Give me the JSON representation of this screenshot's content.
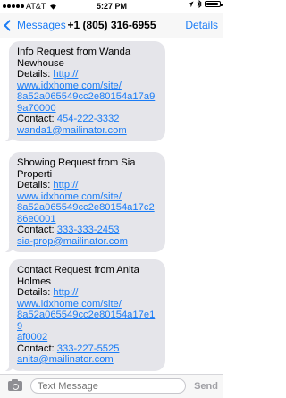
{
  "status_bar": {
    "carrier": "AT&T",
    "time": "5:27 PM",
    "battery_level": 0.95
  },
  "nav": {
    "back_label": "Messages",
    "title": "+1 (805) 316-6955",
    "details_label": "Details"
  },
  "messages": [
    {
      "title_lines": [
        "Info Request from Wanda",
        "Newhouse"
      ],
      "details_label": "Details: ",
      "url_lines": [
        "http://",
        "www.idxhome.com/site/",
        "8a52a065549cc2e80154a17a9",
        "9a70000"
      ],
      "contact_label": "Contact: ",
      "phone": "454-222-3332",
      "email": "wanda1@mailinator.com"
    },
    {
      "title_lines": [
        "Showing Request from Sia",
        "Properti"
      ],
      "details_label": "Details: ",
      "url_lines": [
        "http://",
        "www.idxhome.com/site/",
        "8a52a065549cc2e80154a17c2",
        "86e0001"
      ],
      "contact_label": "Contact: ",
      "phone": "333-333-2453",
      "email": "sia-prop@mailinator.com"
    },
    {
      "title_lines": [
        "Contact Request from Anita",
        "Holmes"
      ],
      "details_label": "Details: ",
      "url_lines": [
        "http://",
        "www.idxhome.com/site/",
        "8a52a065549cc2e80154a17e19",
        "af0002"
      ],
      "contact_label": "Contact: ",
      "phone": "333-227-5525",
      "email": "anita@mailinator.com"
    }
  ],
  "input_bar": {
    "placeholder": "Text Message",
    "send_label": "Send"
  },
  "colors": {
    "accent": "#1a7cf6",
    "bubble": "#e5e5ea"
  }
}
